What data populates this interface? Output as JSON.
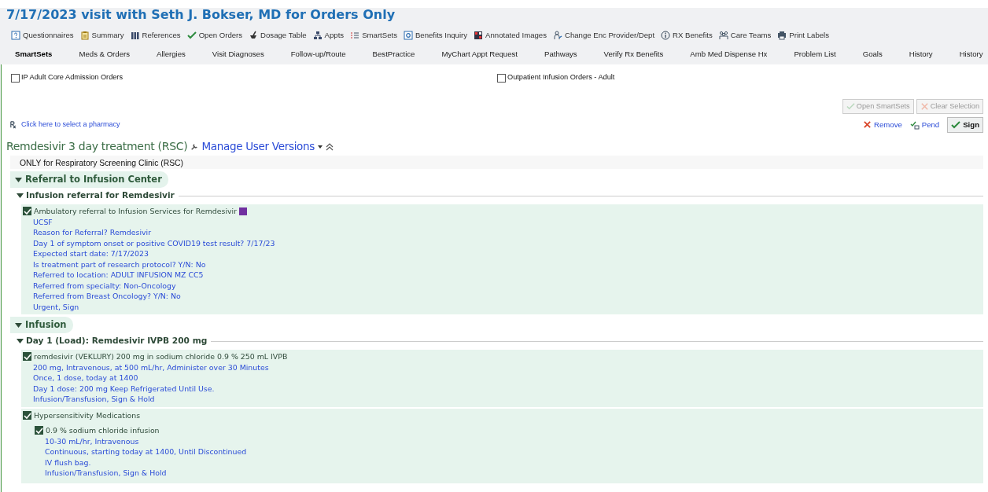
{
  "window": {
    "title": "7/17/2023 visit with Seth J. Bokser, MD for Orders Only"
  },
  "toolbar": [
    {
      "label": "Questionnaires",
      "kind": "question"
    },
    {
      "label": "Summary",
      "kind": "clipboard"
    },
    {
      "label": "References",
      "kind": "books"
    },
    {
      "label": "Open Orders",
      "kind": "check"
    },
    {
      "label": "Dosage Table",
      "kind": "mortar"
    },
    {
      "label": "Appts",
      "kind": "network"
    },
    {
      "label": "SmartSets",
      "kind": "list"
    },
    {
      "label": "Benefits Inquiry",
      "kind": "search"
    },
    {
      "label": "Annotated Images",
      "kind": "image"
    },
    {
      "label": "Change Enc Provider/Dept",
      "kind": "person"
    },
    {
      "label": "RX Benefits",
      "kind": "info"
    },
    {
      "label": "Care Teams",
      "kind": "people"
    },
    {
      "label": "Print Labels",
      "kind": "printer"
    }
  ],
  "tabs": [
    {
      "label": "SmartSets",
      "selected": true
    },
    {
      "label": "Meds & Orders",
      "selected": false
    },
    {
      "label": "Allergies",
      "selected": false
    },
    {
      "label": "Visit Diagnoses",
      "selected": false
    },
    {
      "label": "Follow-up/Route",
      "selected": false
    },
    {
      "label": "BestPractice",
      "selected": false
    },
    {
      "label": "MyChart Appt Request",
      "selected": false
    },
    {
      "label": "Pathways",
      "selected": false
    },
    {
      "label": "Verify Rx Benefits",
      "selected": false
    },
    {
      "label": "Amb Med Dispense Hx",
      "selected": false
    },
    {
      "label": "Problem List",
      "selected": false
    },
    {
      "label": "Goals",
      "selected": false
    },
    {
      "label": "History",
      "selected": false
    },
    {
      "label": "History",
      "selected": false
    }
  ],
  "favorites": [
    {
      "label": "IP Adult Core Admission Orders",
      "checked": false
    },
    {
      "label": "Outpatient Infusion Orders - Adult",
      "checked": false
    }
  ],
  "favorite_buttons": [
    {
      "label": "Open SmartSets",
      "kind": "check",
      "disabled": true
    },
    {
      "label": "Clear Selection",
      "kind": "cross",
      "disabled": true
    }
  ],
  "pharmacy_link": "Click here to select a pharmacy",
  "actions": [
    {
      "label": "Remove",
      "kind": "remove"
    },
    {
      "label": "Pend",
      "kind": "pend"
    },
    {
      "label": "Sign",
      "kind": "sign"
    }
  ],
  "smartset": {
    "title": "Remdesivir 3 day treatment (RSC)",
    "versions_link": "Manage User Versions",
    "note": "ONLY for Respiratory Screening Clinic (RSC)",
    "sections": [
      {
        "title": "Referral to Infusion Center",
        "expanded": true,
        "groups": [
          {
            "title": "Infusion referral for Remdesivir",
            "expanded": true,
            "orders": [
              {
                "name": "Ambulatory referral to Infusion Services for Remdesivir",
                "checked": true,
                "color": "#7030a0",
                "details": [
                  "UCSF",
                  "Reason for Referral? Remdesivir",
                  "Day 1 of symptom onset or positive COVID19 test result? 7/17/23",
                  "Expected start date: 7/17/2023",
                  "Is treatment part of research protocol? Y/N: No",
                  "Referred to location: ADULT INFUSION MZ CC5",
                  "Referred from specialty: Non-Oncology",
                  "Referred from Breast Oncology? Y/N: No",
                  "Urgent, Sign"
                ]
              }
            ]
          }
        ]
      },
      {
        "title": "Infusion",
        "expanded": true,
        "groups": [
          {
            "title": "Day 1 (Load): Remdesivir IVPB 200 mg",
            "expanded": true,
            "orders": [
              {
                "name": "remdesivir (VEKLURY) 200 mg in sodium chloride 0.9 % 250 mL IVPB",
                "checked": true,
                "details": [
                  "200 mg, Intravenous, at 500 mL/hr, Administer over 30 Minutes",
                  "Once, 1 dose, today at 1400",
                  "Day 1 dose: 200 mg Keep Refrigerated Until Use.",
                  "Infusion/Transfusion, Sign & Hold"
                ]
              },
              {
                "name": "Hypersensitivity Medications",
                "checked": true,
                "children": [
                  {
                    "name": "0.9 % sodium chloride infusion",
                    "checked": true,
                    "details": [
                      "10-30 mL/hr, Intravenous",
                      "Continuous, starting today at 1400, Until Discontinued",
                      "IV flush bag.",
                      "Infusion/Transfusion, Sign & Hold"
                    ]
                  }
                ]
              }
            ]
          }
        ]
      }
    ]
  }
}
